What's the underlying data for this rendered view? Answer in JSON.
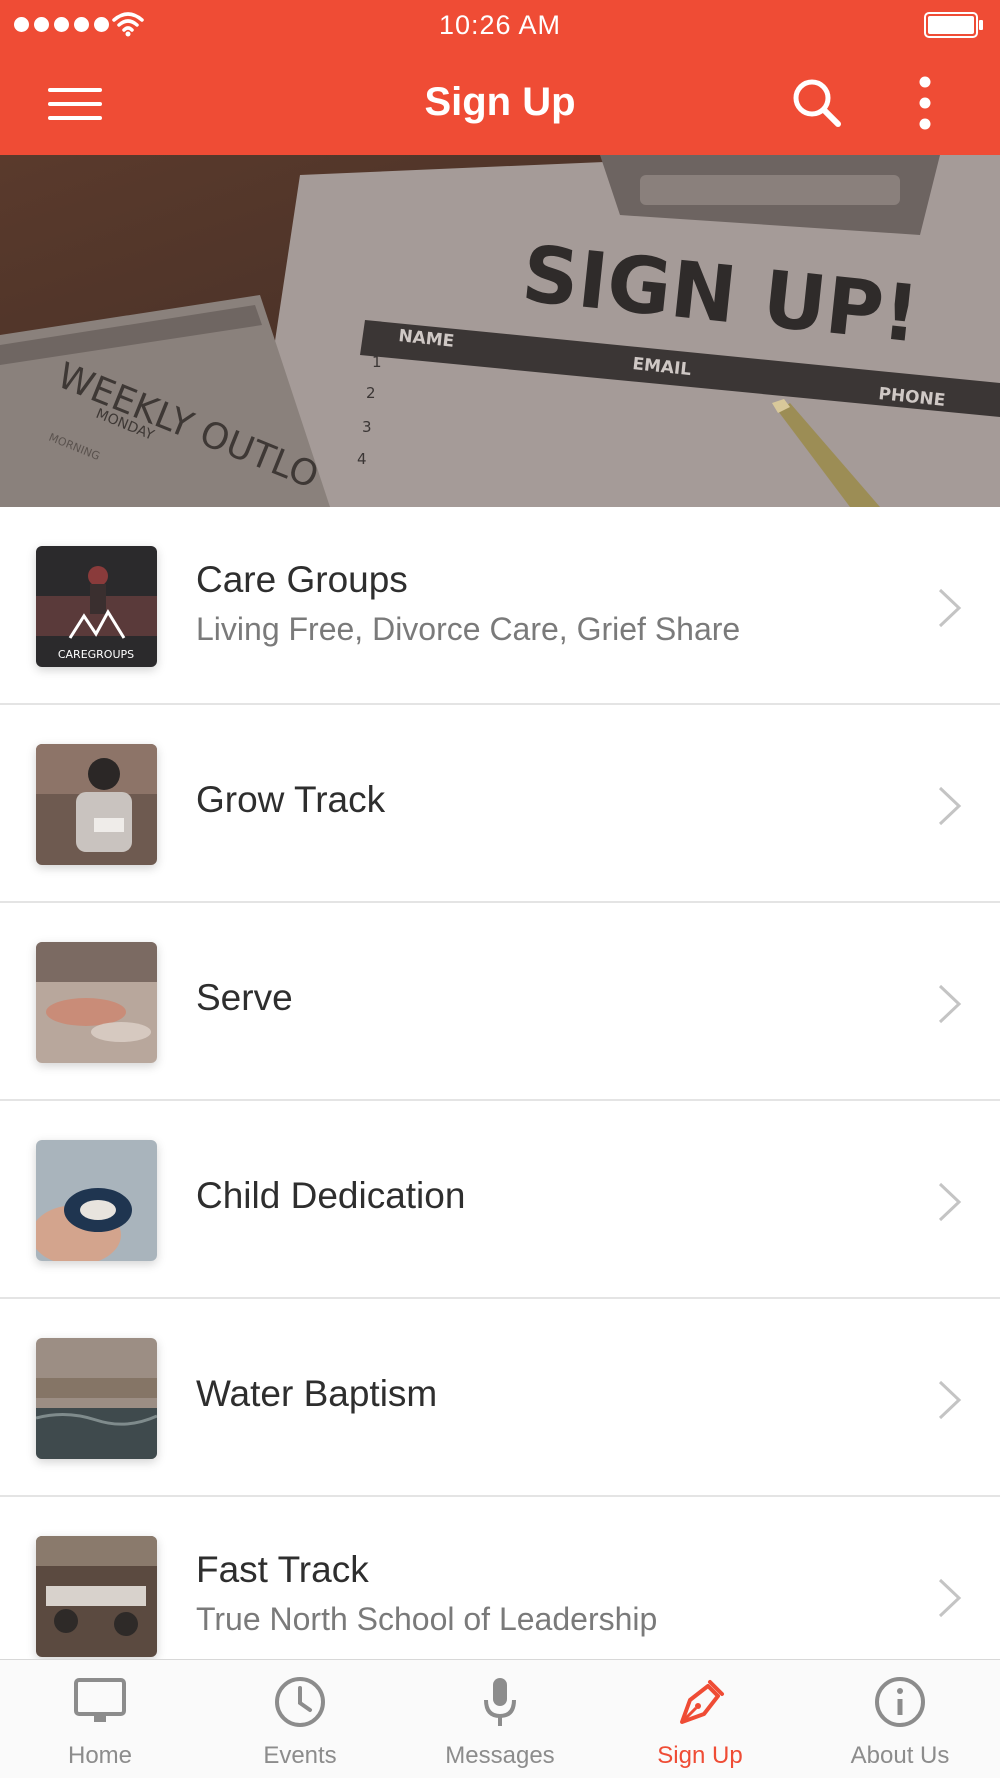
{
  "colors": {
    "accent": "#ef4c35",
    "tab_inactive": "#8c8c8c",
    "divider": "#e4e4e4"
  },
  "status_bar": {
    "time": "10:26 AM"
  },
  "nav": {
    "title": "Sign Up",
    "menu_icon": "hamburger-icon",
    "search_icon": "search-icon",
    "more_icon": "more-vertical-icon"
  },
  "hero": {
    "heading": "SIGN UP!",
    "columns": [
      "NAME",
      "EMAIL",
      "PHONE"
    ],
    "row_numbers": [
      "1",
      "2",
      "3",
      "4"
    ],
    "notebook_text": "WEEKLY OUTLO",
    "notebook_day": "MONDAY",
    "notebook_sub": "MORNING"
  },
  "list": {
    "items": [
      {
        "title": "Care Groups",
        "subtitle": "Living Free, Divorce Care, Grief Share",
        "thumb_text": "CAREGROUPS"
      },
      {
        "title": "Grow Track"
      },
      {
        "title": "Serve"
      },
      {
        "title": "Child Dedication"
      },
      {
        "title": "Water Baptism"
      },
      {
        "title": "Fast Track",
        "subtitle": "True North School of Leadership"
      }
    ]
  },
  "tabs": [
    {
      "label": "Home",
      "icon": "monitor-icon",
      "active": false
    },
    {
      "label": "Events",
      "icon": "clock-icon",
      "active": false
    },
    {
      "label": "Messages",
      "icon": "microphone-icon",
      "active": false
    },
    {
      "label": "Sign Up",
      "icon": "pen-icon",
      "active": true
    },
    {
      "label": "About Us",
      "icon": "info-icon",
      "active": false
    }
  ]
}
